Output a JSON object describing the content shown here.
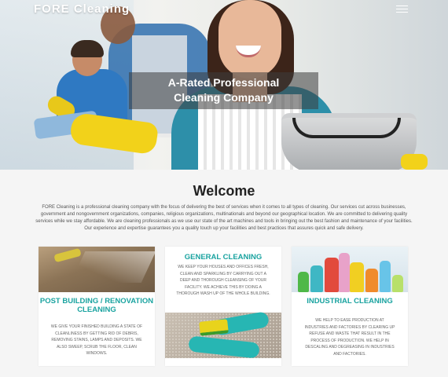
{
  "header": {
    "brand": "FORE Cleaning",
    "menu_icon": "hamburger-menu-icon"
  },
  "hero": {
    "tagline_line1": "A-Rated Professional",
    "tagline_line2": "Cleaning Company"
  },
  "welcome": {
    "title": "Welcome",
    "text": "FORE Cleaning is a professional cleaning company with the focus of delivering the best of services when it comes to all types of cleaning. Our services cut across businesses, government and nongovernment organizations, companies, religious organizations, multinationals and beyond our geographical location. We are committed to delivering quality services while we stay affordable. We are cleaning professionals as we use our state of the art machines and tools in bringing out the best fashion and maintenance of your facilities. Our experience and expertise guarantees you a quality touch up your facilities and best practices that assures quick and safe delivery."
  },
  "services": [
    {
      "title": "POST BUILDING / RENOVATION CLEANING",
      "text": "WE GIVE YOUR FINISHED BUILDING A STATE OF CLEANLINESS BY GETTING RID OF DEBRIS, REMOVING STAINS, LAMPS AND DEPOSITS. WE ALSO SWEEP, SCRUB THE FLOOR, CLEAN WINDOWS."
    },
    {
      "title": "GENERAL CLEANING",
      "text": "WE KEEP YOUR HOUSES AND OFFICES FRESH, CLEAN AND SPARKLING BY CARRYING OUT A DEEP AND THOROUGH CLEANSING OF YOUR FACILITY. WE ACHIEVE THIS BY DOING A THOROUGH WASH UP OF THE WHOLE BUILDING."
    },
    {
      "title": "INDUSTRIAL CLEANING",
      "text": "WE HELP TO EASE PRODUCTION AT INDUSTRIES AND FACTORIES BY CLEARING UP REFUSE AND WASTE THAT RESULT IN THE PROCESS OF PRODUCTION. WE HELP IN DESCALING AND DEGREASING IN INDUSTRIES AND FACTORIES."
    }
  ],
  "colors": {
    "accent": "#1aa3a0",
    "background": "#f5f5f5"
  }
}
